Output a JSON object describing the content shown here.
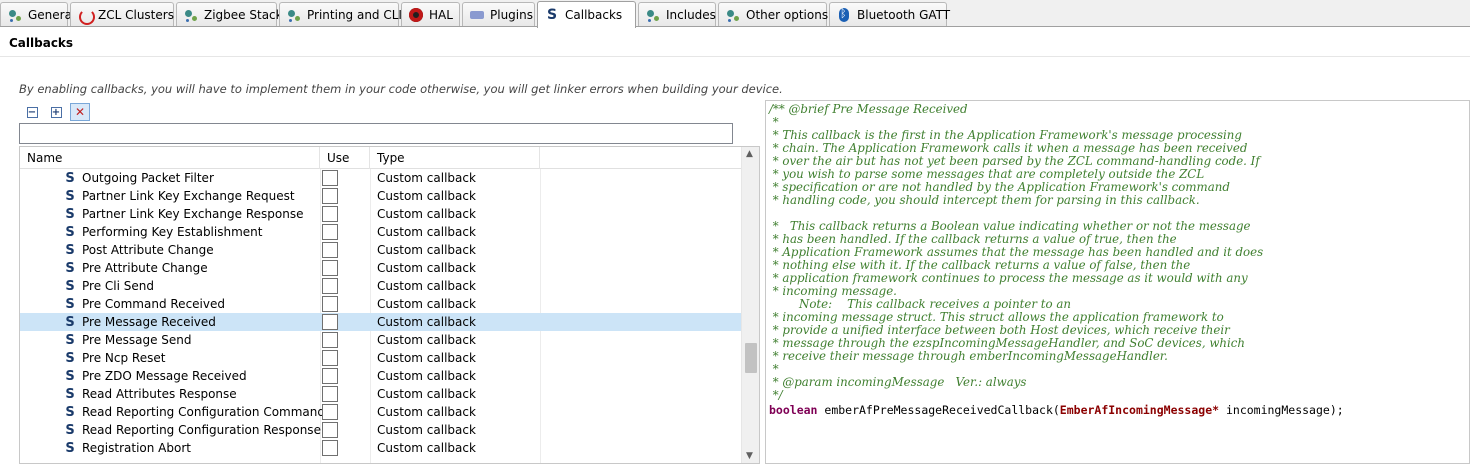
{
  "tabs": [
    {
      "label": "General",
      "icon": "gear-icon"
    },
    {
      "label": "ZCL Clusters",
      "icon": "zcl-icon"
    },
    {
      "label": "Zigbee Stack",
      "icon": "gear-icon"
    },
    {
      "label": "Printing and CLI",
      "icon": "gear-icon"
    },
    {
      "label": "HAL",
      "icon": "hal-icon"
    },
    {
      "label": "Plugins",
      "icon": "plugin-icon"
    },
    {
      "label": "Callbacks",
      "icon": "callback-icon",
      "active": true
    },
    {
      "label": "Includes",
      "icon": "gear-icon"
    },
    {
      "label": "Other options",
      "icon": "gear-icon"
    },
    {
      "label": "Bluetooth GATT",
      "icon": "bluetooth-icon"
    }
  ],
  "section": {
    "title": "Callbacks",
    "hint": "By enabling callbacks, you will have to implement them in your code otherwise, you will get linker errors when building your device."
  },
  "toolbar": [
    {
      "name": "collapse-all-button",
      "glyph": "−"
    },
    {
      "name": "expand-all-button",
      "glyph": "+"
    },
    {
      "name": "filter-toggle-button",
      "glyph": "✕"
    }
  ],
  "filter": {
    "value": ""
  },
  "table": {
    "columns": [
      "Name",
      "Use",
      "Type"
    ],
    "rows": [
      {
        "name": "Outgoing Packet Filter",
        "type": "Custom callback"
      },
      {
        "name": "Partner Link Key Exchange Request",
        "type": "Custom callback"
      },
      {
        "name": "Partner Link Key Exchange Response",
        "type": "Custom callback"
      },
      {
        "name": "Performing Key Establishment",
        "type": "Custom callback"
      },
      {
        "name": "Post Attribute Change",
        "type": "Custom callback"
      },
      {
        "name": "Pre Attribute Change",
        "type": "Custom callback"
      },
      {
        "name": "Pre Cli Send",
        "type": "Custom callback"
      },
      {
        "name": "Pre Command Received",
        "type": "Custom callback"
      },
      {
        "name": "Pre Message Received",
        "type": "Custom callback",
        "selected": true
      },
      {
        "name": "Pre Message Send",
        "type": "Custom callback"
      },
      {
        "name": "Pre Ncp Reset",
        "type": "Custom callback"
      },
      {
        "name": "Pre ZDO Message Received",
        "type": "Custom callback"
      },
      {
        "name": "Read Attributes Response",
        "type": "Custom callback"
      },
      {
        "name": "Read Reporting Configuration Command",
        "type": "Custom callback"
      },
      {
        "name": "Read Reporting Configuration Response",
        "type": "Custom callback"
      },
      {
        "name": "Registration Abort",
        "type": "Custom callback"
      }
    ]
  },
  "code": {
    "comment_lines": [
      "/** @brief Pre Message Received",
      " *",
      " * This callback is the first in the Application Framework's message processing",
      " * chain. The Application Framework calls it when a message has been received",
      " * over the air but has not yet been parsed by the ZCL command-handling code. If",
      " * you wish to parse some messages that are completely outside the ZCL",
      " * specification or are not handled by the Application Framework's command",
      " * handling code, you should intercept them for parsing in this callback.",
      "",
      " *   This callback returns a Boolean value indicating whether or not the message",
      " * has been handled. If the callback returns a value of true, then the",
      " * Application Framework assumes that the message has been handled and it does",
      " * nothing else with it. If the callback returns a value of false, then the",
      " * application framework continues to process the message as it would with any",
      " * incoming message.",
      "        Note:    This callback receives a pointer to an",
      " * incoming message struct. This struct allows the application framework to",
      " * provide a unified interface between both Host devices, which receive their",
      " * message through the ezspIncomingMessageHandler, and SoC devices, which",
      " * receive their message through emberIncomingMessageHandler.",
      " *",
      " * @param incomingMessage   Ver.: always",
      " */"
    ],
    "signature": {
      "return_type": "boolean",
      "function": " emberAfPreMessageReceivedCallback(",
      "param_type": "EmberAfIncomingMessage*",
      "param_rest": " incomingMessage);"
    }
  },
  "colors": {
    "comment": "#3f7f2f",
    "keyword": "#7f0055",
    "selection": "#cce4f7"
  }
}
